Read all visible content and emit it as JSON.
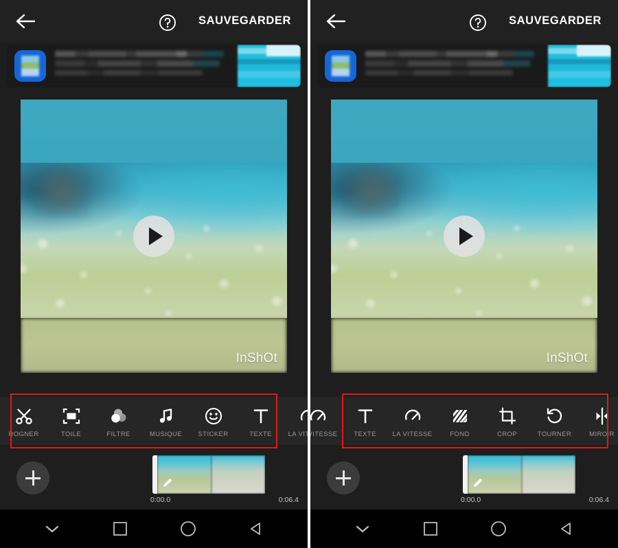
{
  "app": {
    "name": "InShot",
    "watermark": "InShOt",
    "background": "#1e1e1e",
    "accent_red": "#e01b1b"
  },
  "appbar": {
    "back_icon": "arrow-left-icon",
    "help_icon": "question-mark-circle-icon",
    "save_label": "SAUVEGARDER"
  },
  "ad_banner": {
    "app_icon": "app-icon-blurred",
    "headline_blurred": true,
    "thumbnail": "ad-thumbnail-blurred"
  },
  "preview": {
    "play_icon": "play-icon",
    "watermark": "InShOt"
  },
  "panels": [
    {
      "id": "left",
      "tools": [
        {
          "label": "ROGNER",
          "icon": "scissors-icon"
        },
        {
          "label": "TOILE",
          "icon": "canvas-icon"
        },
        {
          "label": "FILTRE",
          "icon": "filter-circles-icon"
        },
        {
          "label": "MUSIQUE",
          "icon": "music-note-icon"
        },
        {
          "label": "STICKER",
          "icon": "smiley-icon"
        },
        {
          "label": "TEXTE",
          "icon": "text-t-icon"
        },
        {
          "label": "LA VITESSE",
          "icon": "speed-gauge-icon"
        }
      ],
      "highlight_from": 0,
      "highlight_to": 5
    },
    {
      "id": "right",
      "tools": [
        {
          "label": "TEXTE",
          "icon": "text-t-icon"
        },
        {
          "label": "LA VITESSE",
          "icon": "speed-gauge-icon"
        },
        {
          "label": "FOND",
          "icon": "diagonal-stripes-icon"
        },
        {
          "label": "CROP",
          "icon": "crop-icon"
        },
        {
          "label": "TOURNER",
          "icon": "rotate-ccw-icon"
        },
        {
          "label": "MIROIR",
          "icon": "mirror-flip-icon"
        }
      ],
      "highlight_from": 0,
      "highlight_to": 5
    }
  ],
  "timeline": {
    "add_label": "+",
    "add_icon": "plus-icon",
    "edit_icon": "pencil-icon",
    "time_start": "0:00.0",
    "time_end": "0:06.4"
  },
  "navbar": {
    "items": [
      {
        "icon": "chevron-down-icon"
      },
      {
        "icon": "square-recents-icon"
      },
      {
        "icon": "circle-home-icon"
      },
      {
        "icon": "triangle-back-icon"
      }
    ]
  }
}
